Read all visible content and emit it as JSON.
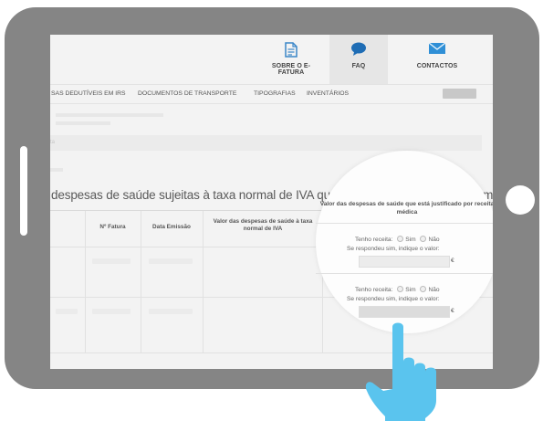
{
  "header": {
    "nav": [
      {
        "label": "SOBRE O E-FATURA",
        "icon": "document-icon"
      },
      {
        "label": "FAQ",
        "icon": "speech-bubble-icon"
      },
      {
        "label": "CONTACTOS",
        "icon": "envelope-icon"
      }
    ]
  },
  "menu": {
    "items": [
      "SAS DEDUTÍVEIS EM IRS",
      "DOCUMENTOS DE TRANSPORTE",
      "TIPOGRAFIAS",
      "INVENTÁRIOS"
    ]
  },
  "search": {
    "text": "ta"
  },
  "main": {
    "title": "despesas de saúde sujeitas à taxa normal de IVA que está justificado por receita médica"
  },
  "table": {
    "headers": [
      "Nº Fatura",
      "Data Emissão",
      "Valor das despesas de saúde à taxa normal de IVA",
      "Valor das despesas de saúde que está justificado por receita médica"
    ],
    "rows": [
      {
        "question": "Tenho receita:",
        "yes": "Sim",
        "no": "Não",
        "hint": "Se respondeu sim, indique o valor:",
        "currency": "€"
      },
      {
        "question": "Tenho receita:",
        "yes": "Sim",
        "no": "Não",
        "hint": "Se respondeu sim, indique o valor:",
        "currency": "€"
      }
    ]
  },
  "colors": {
    "tablet": "#858585",
    "hand": "#5ac4ee",
    "screen": "#f3f3f3",
    "icon": "#3a86c8"
  }
}
